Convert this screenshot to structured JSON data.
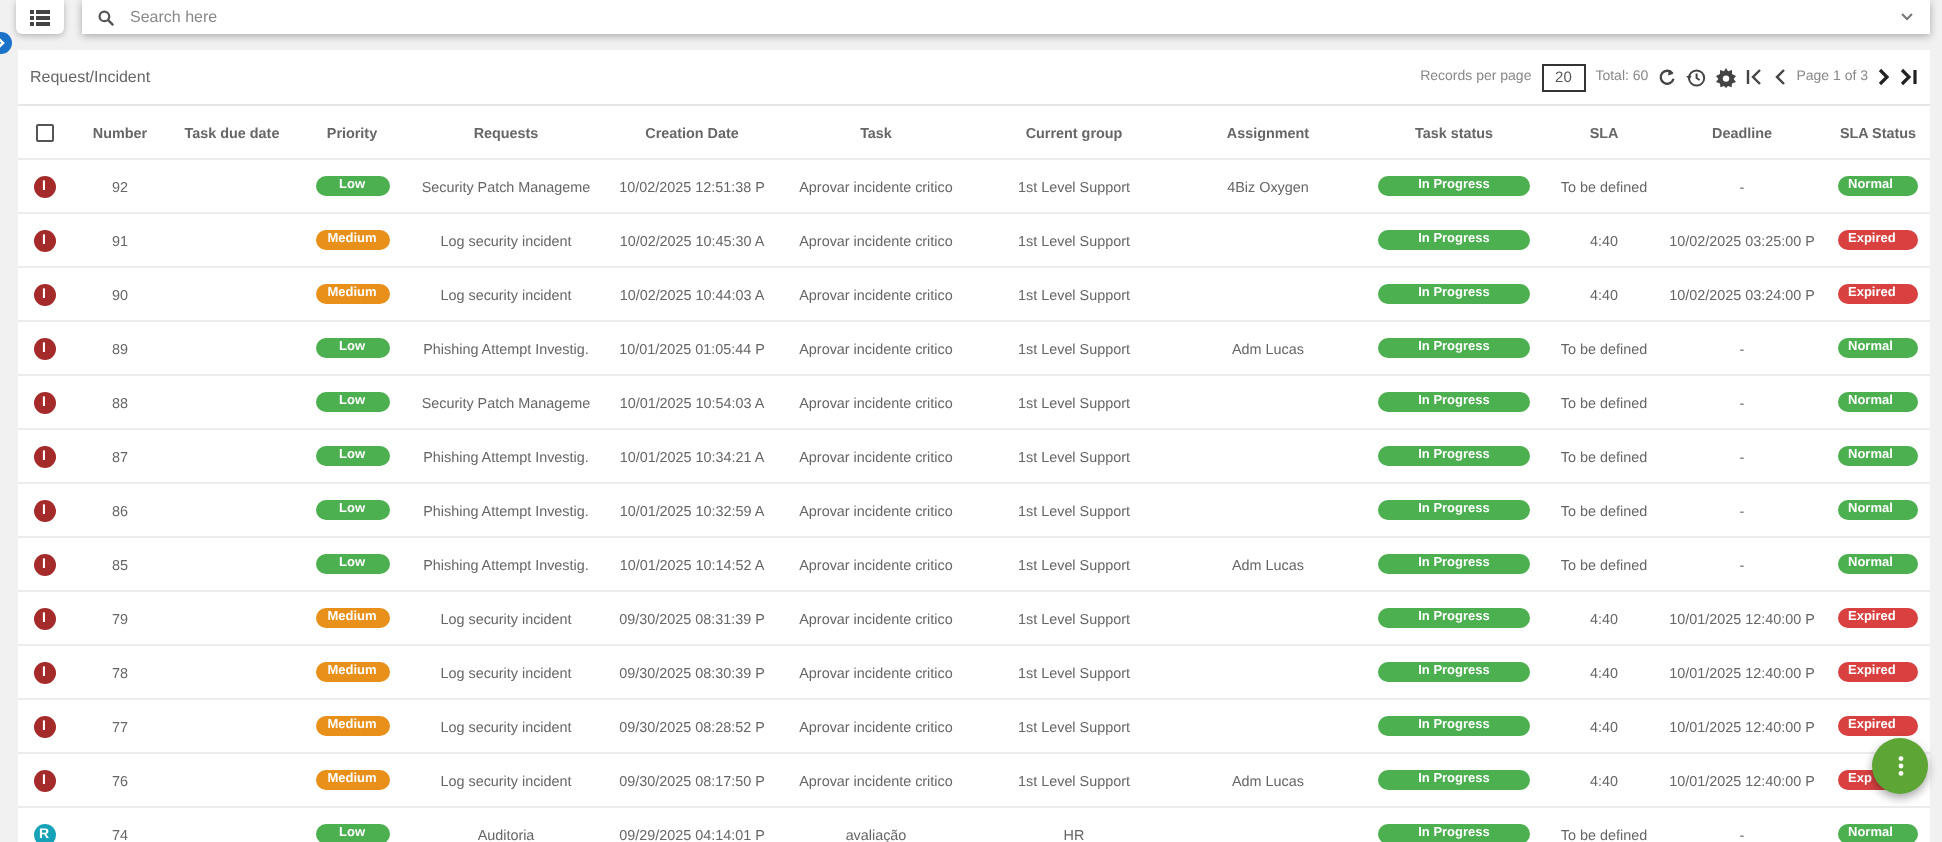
{
  "search": {
    "placeholder": "Search here"
  },
  "panel": {
    "title": "Request/Incident"
  },
  "pager": {
    "records_label": "Records per page",
    "records_value": "20",
    "total": "Total: 60",
    "page": "Page 1 of 3"
  },
  "table": {
    "select_all": {
      "checked": false
    },
    "columns": [
      "Number",
      "Task due date",
      "Priority",
      "Requests",
      "Creation Date",
      "Task",
      "Current group",
      "Assignment",
      "Task status",
      "SLA",
      "Deadline",
      "SLA Status"
    ],
    "rows": [
      {
        "kind": "incident",
        "letter": "I",
        "number": "92",
        "priority": {
          "text": "Low",
          "color": "#4caf50"
        },
        "request": "Security Patch Manageme",
        "created": "10/02/2025 12:51:38 P",
        "task": "Aprovar incidente critico",
        "group": "1st Level Support",
        "assignment": "4Biz Oxygen",
        "task_status": {
          "text": "In Progress",
          "color": "#4caf50"
        },
        "sla": "To be defined",
        "deadline": "-",
        "sla_status": {
          "text": "Normal",
          "color": "#4caf50"
        }
      },
      {
        "kind": "incident",
        "letter": "I",
        "number": "91",
        "priority": {
          "text": "Medium",
          "color": "#e8901a"
        },
        "request": "Log security incident",
        "created": "10/02/2025 10:45:30 A",
        "task": "Aprovar incidente critico",
        "group": "1st Level Support",
        "task_status": {
          "text": "In Progress",
          "color": "#4caf50"
        },
        "sla": "4:40",
        "deadline": "10/02/2025 03:25:00 P",
        "sla_status": {
          "text": "Expired",
          "color": "#d94141"
        }
      },
      {
        "kind": "incident",
        "letter": "I",
        "number": "90",
        "priority": {
          "text": "Medium",
          "color": "#e8901a"
        },
        "request": "Log security incident",
        "created": "10/02/2025 10:44:03 A",
        "task": "Aprovar incidente critico",
        "group": "1st Level Support",
        "task_status": {
          "text": "In Progress",
          "color": "#4caf50"
        },
        "sla": "4:40",
        "deadline": "10/02/2025 03:24:00 P",
        "sla_status": {
          "text": "Expired",
          "color": "#d94141"
        }
      },
      {
        "kind": "incident",
        "letter": "I",
        "number": "89",
        "priority": {
          "text": "Low",
          "color": "#4caf50"
        },
        "request": "Phishing Attempt Investig.",
        "created": "10/01/2025 01:05:44 P",
        "task": "Aprovar incidente critico",
        "group": "1st Level Support",
        "assignment": "Adm Lucas",
        "task_status": {
          "text": "In Progress",
          "color": "#4caf50"
        },
        "sla": "To be defined",
        "deadline": "-",
        "sla_status": {
          "text": "Normal",
          "color": "#4caf50"
        }
      },
      {
        "kind": "incident",
        "letter": "I",
        "number": "88",
        "priority": {
          "text": "Low",
          "color": "#4caf50"
        },
        "request": "Security Patch Manageme",
        "created": "10/01/2025 10:54:03 A",
        "task": "Aprovar incidente critico",
        "group": "1st Level Support",
        "task_status": {
          "text": "In Progress",
          "color": "#4caf50"
        },
        "sla": "To be defined",
        "deadline": "-",
        "sla_status": {
          "text": "Normal",
          "color": "#4caf50"
        }
      },
      {
        "kind": "incident",
        "letter": "I",
        "number": "87",
        "priority": {
          "text": "Low",
          "color": "#4caf50"
        },
        "request": "Phishing Attempt Investig.",
        "created": "10/01/2025 10:34:21 A",
        "task": "Aprovar incidente critico",
        "group": "1st Level Support",
        "task_status": {
          "text": "In Progress",
          "color": "#4caf50"
        },
        "sla": "To be defined",
        "deadline": "-",
        "sla_status": {
          "text": "Normal",
          "color": "#4caf50"
        }
      },
      {
        "kind": "incident",
        "letter": "I",
        "number": "86",
        "priority": {
          "text": "Low",
          "color": "#4caf50"
        },
        "request": "Phishing Attempt Investig.",
        "created": "10/01/2025 10:32:59 A",
        "task": "Aprovar incidente critico",
        "group": "1st Level Support",
        "task_status": {
          "text": "In Progress",
          "color": "#4caf50"
        },
        "sla": "To be defined",
        "deadline": "-",
        "sla_status": {
          "text": "Normal",
          "color": "#4caf50"
        }
      },
      {
        "kind": "incident",
        "letter": "I",
        "number": "85",
        "priority": {
          "text": "Low",
          "color": "#4caf50"
        },
        "request": "Phishing Attempt Investig.",
        "created": "10/01/2025 10:14:52 A",
        "task": "Aprovar incidente critico",
        "group": "1st Level Support",
        "assignment": "Adm Lucas",
        "task_status": {
          "text": "In Progress",
          "color": "#4caf50"
        },
        "sla": "To be defined",
        "deadline": "-",
        "sla_status": {
          "text": "Normal",
          "color": "#4caf50"
        }
      },
      {
        "kind": "incident",
        "letter": "I",
        "number": "79",
        "priority": {
          "text": "Medium",
          "color": "#e8901a"
        },
        "request": "Log security incident",
        "created": "09/30/2025 08:31:39 P",
        "task": "Aprovar incidente critico",
        "group": "1st Level Support",
        "task_status": {
          "text": "In Progress",
          "color": "#4caf50"
        },
        "sla": "4:40",
        "deadline": "10/01/2025 12:40:00 P",
        "sla_status": {
          "text": "Expired",
          "color": "#d94141"
        }
      },
      {
        "kind": "incident",
        "letter": "I",
        "number": "78",
        "priority": {
          "text": "Medium",
          "color": "#e8901a"
        },
        "request": "Log security incident",
        "created": "09/30/2025 08:30:39 P",
        "task": "Aprovar incidente critico",
        "group": "1st Level Support",
        "task_status": {
          "text": "In Progress",
          "color": "#4caf50"
        },
        "sla": "4:40",
        "deadline": "10/01/2025 12:40:00 P",
        "sla_status": {
          "text": "Expired",
          "color": "#d94141"
        }
      },
      {
        "kind": "incident",
        "letter": "I",
        "number": "77",
        "priority": {
          "text": "Medium",
          "color": "#e8901a"
        },
        "request": "Log security incident",
        "created": "09/30/2025 08:28:52 P",
        "task": "Aprovar incidente critico",
        "group": "1st Level Support",
        "task_status": {
          "text": "In Progress",
          "color": "#4caf50"
        },
        "sla": "4:40",
        "deadline": "10/01/2025 12:40:00 P",
        "sla_status": {
          "text": "Expired",
          "color": "#d94141"
        }
      },
      {
        "kind": "incident",
        "letter": "I",
        "number": "76",
        "priority": {
          "text": "Medium",
          "color": "#e8901a"
        },
        "request": "Log security incident",
        "created": "09/30/2025 08:17:50 P",
        "task": "Aprovar incidente critico",
        "group": "1st Level Support",
        "assignment": "Adm Lucas",
        "task_status": {
          "text": "In Progress",
          "color": "#4caf50"
        },
        "sla": "4:40",
        "deadline": "10/01/2025 12:40:00 P",
        "sla_status": {
          "text": "Exp",
          "color": "#d94141"
        }
      },
      {
        "kind": "request",
        "letter": "R",
        "number": "74",
        "priority": {
          "text": "Low",
          "color": "#4caf50"
        },
        "request": "Auditoria",
        "created": "09/29/2025 04:14:01 P",
        "task": "avaliação",
        "group": "HR",
        "task_status": {
          "text": "In Progress",
          "color": "#4caf50"
        },
        "sla": "To be defined",
        "deadline": "-",
        "sla_status": {
          "text": "Normal",
          "color": "#4caf50"
        }
      }
    ]
  }
}
